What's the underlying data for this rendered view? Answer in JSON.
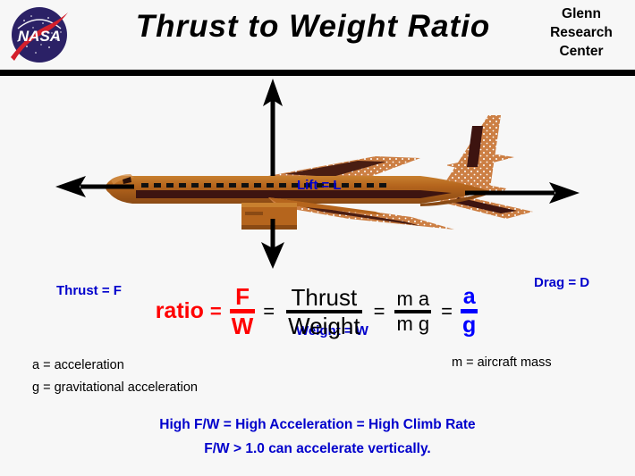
{
  "header": {
    "title": "Thrust  to  Weight  Ratio",
    "logo_alt": "NASA",
    "logo_wordmark": "NASA",
    "center_line1": "Glenn",
    "center_line2": "Research",
    "center_line3": "Center"
  },
  "diagram": {
    "labels": {
      "lift": "Lift = L",
      "thrust": "Thrust = F",
      "drag": "Drag = D",
      "weight": "Weight = W"
    },
    "aircraft_alt": "side view of a jet airliner"
  },
  "equation": {
    "ratio_word": "ratio",
    "equals_1": "=",
    "equals_2": "=",
    "equals_3": "=",
    "equals_4": "=",
    "fw_numerator": "F",
    "fw_denominator": "W",
    "tw_numerator": "Thrust",
    "tw_denominator": "Weight",
    "mamg_numerator": "m a",
    "mamg_denominator": "m g",
    "ag_numerator": "a",
    "ag_denominator": "g"
  },
  "definitions": {
    "a": "a  =  acceleration",
    "g": "g  =  gravitational  acceleration",
    "m": "m  =  aircraft  mass"
  },
  "conclusions": {
    "line1": "High  F/W =  High  Acceleration = High  Climb  Rate",
    "line2": "F/W  > 1.0  can  accelerate vertically."
  },
  "colors": {
    "background": "#f7f7f7",
    "rule": "#000000",
    "label_blue": "#0000CC",
    "equation_red": "#FF0000",
    "equation_blue": "#0000FF",
    "fuselage": "#b5651d",
    "fuselage_light": "#c87f3c",
    "wing": "#cc7f44",
    "belly_dark": "#3d1410",
    "nasa_blue": "#2b2166",
    "nasa_red": "#d4202c"
  }
}
